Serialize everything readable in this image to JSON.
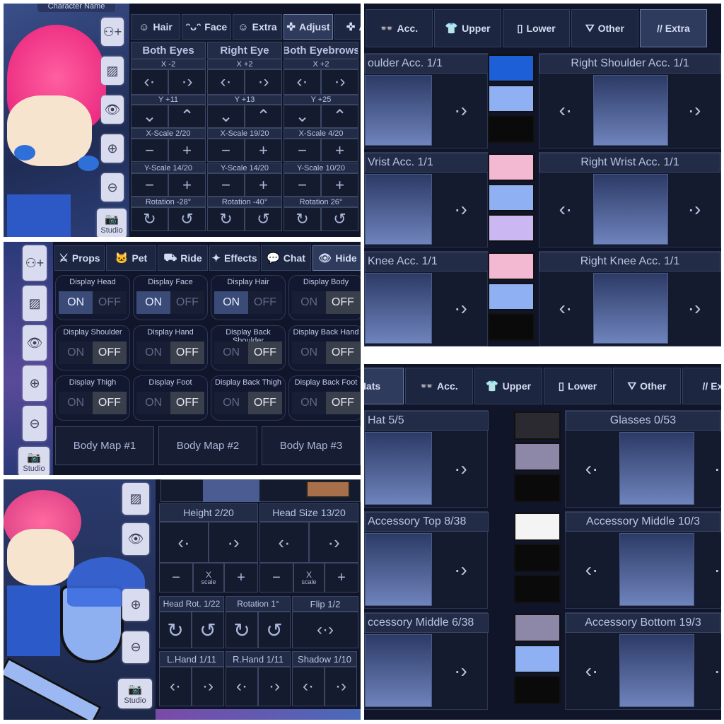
{
  "colors": {
    "panel_bg": "#10152a",
    "accent": "#3a4b78"
  },
  "panel1": {
    "tabs": [
      {
        "label": "Hair",
        "icon": "hair-icon"
      },
      {
        "label": "Face",
        "icon": "face-icon"
      },
      {
        "label": "Extra",
        "icon": "extra-icon"
      },
      {
        "label": "Adjust",
        "icon": "move-icon",
        "active": true
      },
      {
        "label": "Ad",
        "icon": "move-icon"
      }
    ],
    "header_partial": "Character Name",
    "sidebar": [
      "add-character-icon",
      "background-icon",
      "eye-icon",
      "zoom-in-icon",
      "zoom-out-icon"
    ],
    "studio_label": "Studio",
    "columns": [
      {
        "title": "Both Eyes",
        "x": "X -2",
        "y": "Y +11",
        "xscale": "X-Scale 2/20",
        "yscale": "Y-Scale 14/20",
        "rotation": "Rotation -28°"
      },
      {
        "title": "Right Eye",
        "x": "X +2",
        "y": "Y +13",
        "xscale": "X-Scale 19/20",
        "yscale": "Y-Scale 14/20",
        "rotation": "Rotation -40°"
      },
      {
        "title": "Both Eyebrows",
        "x": "X +2",
        "y": "Y +25",
        "xscale": "X-Scale 4/20",
        "yscale": "Y-Scale 10/20",
        "rotation": "Rotation 26°"
      }
    ]
  },
  "panel2": {
    "tabs": [
      {
        "label": "Props",
        "icon": "sword-icon"
      },
      {
        "label": "Pet",
        "icon": "cat-icon"
      },
      {
        "label": "Ride",
        "icon": "car-icon"
      },
      {
        "label": "Effects",
        "icon": "sparkle-icon"
      },
      {
        "label": "Chat",
        "icon": "chat-icon"
      },
      {
        "label": "Hide",
        "icon": "eye-icon",
        "active": true
      }
    ],
    "on_label": "ON",
    "off_label": "OFF",
    "toggles": [
      {
        "label": "Display Head",
        "on": true
      },
      {
        "label": "Display Face",
        "on": true
      },
      {
        "label": "Display Hair",
        "on": true
      },
      {
        "label": "Display Body",
        "on": false
      },
      {
        "label": "Display Shoulder",
        "on": false
      },
      {
        "label": "Display Hand",
        "on": false
      },
      {
        "label": "Display Back Shoulder",
        "on": false
      },
      {
        "label": "Display Back Hand",
        "on": false
      },
      {
        "label": "Display Thigh",
        "on": false
      },
      {
        "label": "Display Foot",
        "on": false
      },
      {
        "label": "Display Back Thigh",
        "on": false
      },
      {
        "label": "Display Back Foot",
        "on": false
      }
    ],
    "body_maps": [
      "Body Map #1",
      "Body Map #2",
      "Body Map #3"
    ],
    "studio_label": "Studio"
  },
  "panel3": {
    "height": "Height 2/20",
    "head_size": "Head Size 13/20",
    "scale_x": "X",
    "scale_sub": "scale",
    "head_rot": "Head Rot. 1/22",
    "rotation": "Rotation 1°",
    "flip": "Flip 1/2",
    "l_hand": "L.Hand 1/11",
    "r_hand": "R.Hand 1/11",
    "shadow": "Shadow 1/10",
    "studio_label": "Studio"
  },
  "panel4": {
    "tabs": [
      {
        "label": "Acc.",
        "icon": "glasses-icon"
      },
      {
        "label": "Upper",
        "icon": "shirt-icon"
      },
      {
        "label": "Lower",
        "icon": "pants-icon"
      },
      {
        "label": "Other",
        "icon": "other-icon"
      },
      {
        "label": "// Extra",
        "icon": "",
        "active": true
      }
    ],
    "rows": [
      {
        "left": "oulder Acc. 1/1",
        "right": "Right Shoulder Acc. 1/1",
        "swatches": [
          "#1d5fd6",
          "#8fb0f2",
          "#0a0a0a"
        ]
      },
      {
        "left": "Vrist Acc. 1/1",
        "right": "Right Wrist Acc. 1/1",
        "swatches": [
          "#f4b9d2",
          "#8fb0f2",
          "#cbb8f2"
        ]
      },
      {
        "left": "Knee Acc. 1/1",
        "right": "Right Knee Acc. 1/1",
        "swatches": [
          "#f4b9d2",
          "#8fb0f2",
          "#0a0a0a"
        ]
      }
    ]
  },
  "panel5": {
    "tabs": [
      {
        "label": "Hats",
        "icon": "",
        "active": true
      },
      {
        "label": "Acc.",
        "icon": "glasses-icon"
      },
      {
        "label": "Upper",
        "icon": "shirt-icon"
      },
      {
        "label": "Lower",
        "icon": "pants-icon"
      },
      {
        "label": "Other",
        "icon": "other-icon"
      },
      {
        "label": "// Extr",
        "icon": ""
      }
    ],
    "rows": [
      {
        "left": "Hat 5/5",
        "right": "Glasses 0/53",
        "swatches": [
          "#2a2a30",
          "#8e88a8",
          "#0a0a0a"
        ]
      },
      {
        "left": "Accessory Top 8/38",
        "right": "Accessory Middle 10/3",
        "swatches": [
          "#f4f4f4",
          "#0a0a0a",
          "#0a0a0a"
        ]
      },
      {
        "left": "ccessory Middle 6/38",
        "right": "Accessory Bottom 19/3",
        "swatches": [
          "#8e88a8",
          "#8fb0f2",
          "#0a0a0a"
        ]
      }
    ]
  }
}
